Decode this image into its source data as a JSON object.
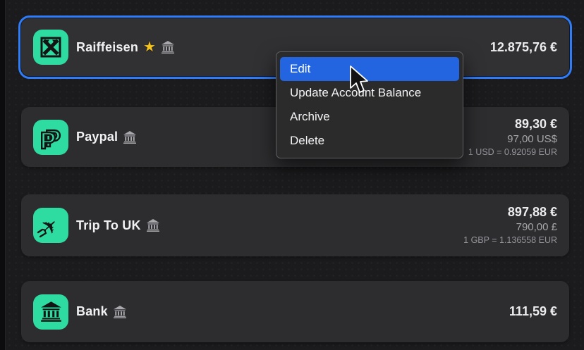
{
  "colors": {
    "accent_green": "#2EDCA2",
    "selection_blue": "#2E7CF8",
    "menu_highlight_blue": "#2365E0",
    "star_gold": "#F5C31D",
    "card_bg": "#2D2D2F",
    "window_bg": "#1B1B1D"
  },
  "icons": {
    "star": "★"
  },
  "accounts": [
    {
      "name": "Raiffeisen",
      "icon": "raiffeisen-logo",
      "starred": true,
      "selected": true,
      "balance_primary": "12.875,76 €"
    },
    {
      "name": "Paypal",
      "icon": "paypal-logo",
      "balance_primary": "89,30 €",
      "balance_secondary": "97,00 US$",
      "exchange_rate": "1 USD = 0.92059 EUR"
    },
    {
      "name": "Trip To UK",
      "icon": "airplane",
      "balance_primary": "897,88 €",
      "balance_secondary": "790,00 £",
      "exchange_rate": "1 GBP = 1.136558 EUR"
    },
    {
      "name": "Bank",
      "icon": "bank-building",
      "balance_primary": "111,59 €"
    }
  ],
  "context_menu": {
    "items": [
      {
        "label": "Edit",
        "highlighted": true
      },
      {
        "label": "Update Account Balance",
        "highlighted": false
      },
      {
        "label": "Archive",
        "highlighted": false
      },
      {
        "label": "Delete",
        "highlighted": false
      }
    ]
  }
}
